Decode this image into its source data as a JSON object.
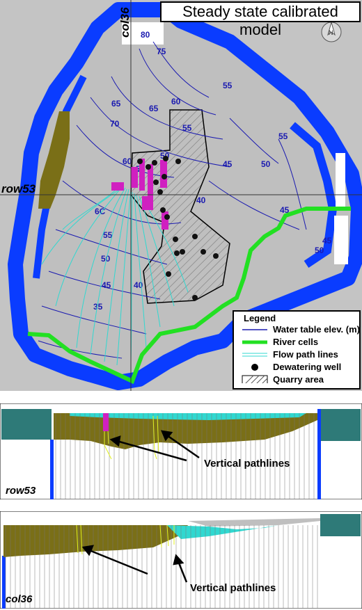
{
  "map": {
    "title": "Steady state calibrated model",
    "row_label": "row53",
    "col_label": "col36",
    "north_label": "N",
    "contours": [
      "80",
      "75",
      "70",
      "65",
      "60",
      "55",
      "50",
      "45",
      "40",
      "35",
      "6C",
      "60",
      "55",
      "50",
      "45",
      "50",
      "55",
      "55",
      "45",
      "45",
      "50",
      "65",
      "50",
      "40"
    ],
    "legend": {
      "title": "Legend",
      "items": [
        {
          "label": "Water table elev. (m)",
          "symbol": "line",
          "color": "#1a1ab0"
        },
        {
          "label": "River cells",
          "symbol": "thick-line",
          "color": "#22e022"
        },
        {
          "label": "Flow path lines",
          "symbol": "double-line",
          "color": "#30d0d0"
        },
        {
          "label": "Dewatering well",
          "symbol": "dot",
          "color": "#000000"
        },
        {
          "label": "Quarry area",
          "symbol": "hatch",
          "color": "#000000"
        }
      ]
    }
  },
  "sections": [
    {
      "label": "row53",
      "annotation": "Vertical pathlines"
    },
    {
      "label": "col36",
      "annotation": "Vertical pathlines"
    }
  ],
  "colors": {
    "model_gray": "#bfbfbf",
    "boundary_blue": "#0a3cff",
    "olive": "#7a6f17",
    "teal": "#2e7a78",
    "cyan": "#30d8d0",
    "magenta": "#d020c0",
    "river_green": "#22e022"
  }
}
